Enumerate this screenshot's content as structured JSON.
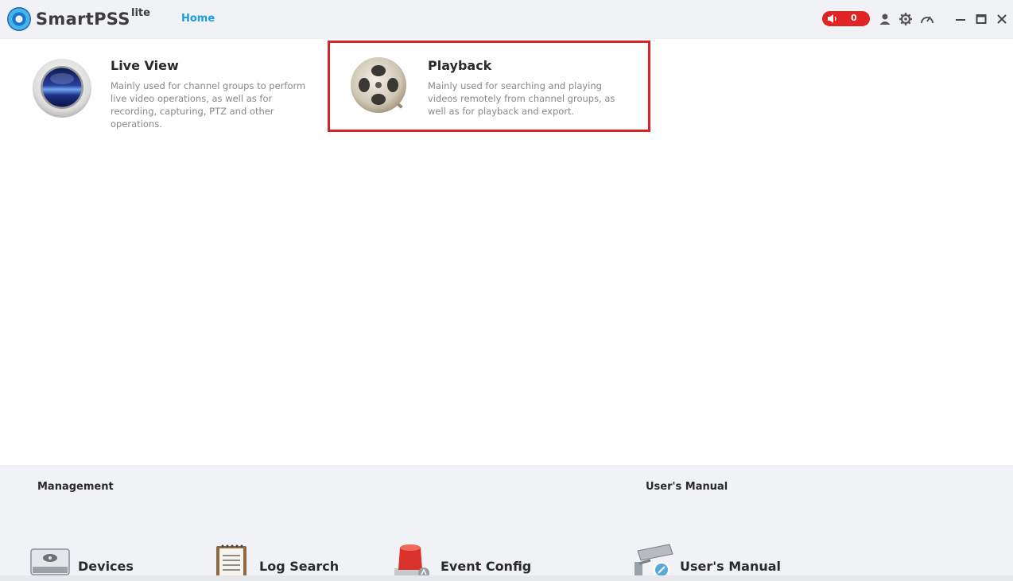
{
  "app": {
    "name": "SmartPSS",
    "suffix": "lite"
  },
  "nav": {
    "home_tab": "Home"
  },
  "toolbar": {
    "alarm_count": "0",
    "icons": [
      "speaker-icon",
      "user-icon",
      "gear-icon",
      "speedometer-icon",
      "minimize-icon",
      "maximize-icon",
      "close-icon"
    ]
  },
  "cards": {
    "live_view": {
      "title": "Live View",
      "description": "Mainly used for channel groups to perform live video operations, as well as for recording, capturing, PTZ and other operations."
    },
    "playback": {
      "title": "Playback",
      "description": "Mainly used for searching and playing videos remotely from channel groups, as well as for playback and export."
    }
  },
  "management": {
    "title": "Management",
    "items": [
      {
        "label": "Devices",
        "icon": "device-icon"
      },
      {
        "label": "Log Search",
        "icon": "notepad-icon"
      },
      {
        "label": "Event Config",
        "icon": "alarm-siren-icon"
      }
    ]
  },
  "manual": {
    "title": "User's Manual",
    "item_label": "User's Manual",
    "icon": "camera-manual-icon"
  },
  "colors": {
    "accent": "#1aa0d8",
    "highlight": "#d8232a",
    "alarm": "#e02424"
  }
}
